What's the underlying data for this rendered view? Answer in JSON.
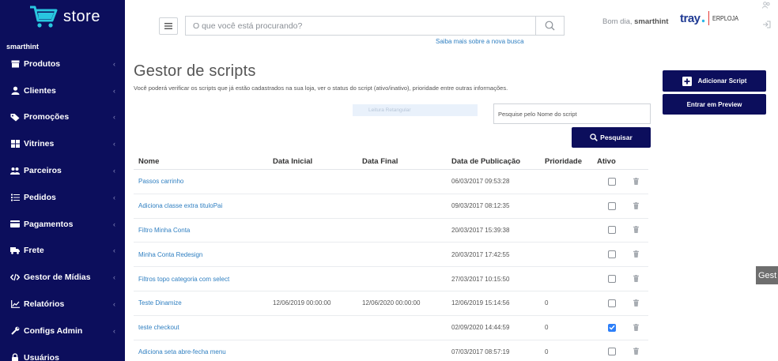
{
  "brand": {
    "logo_text": "store",
    "account": "smarthint"
  },
  "sidebar": {
    "items": [
      {
        "label": "Produtos",
        "icon": "box-icon"
      },
      {
        "label": "Clientes",
        "icon": "user-icon"
      },
      {
        "label": "Promoções",
        "icon": "tag-icon"
      },
      {
        "label": "Vitrines",
        "icon": "grid-icon"
      },
      {
        "label": "Parceiros",
        "icon": "users-icon"
      },
      {
        "label": "Pedidos",
        "icon": "list-icon"
      },
      {
        "label": "Pagamentos",
        "icon": "card-icon"
      },
      {
        "label": "Frete",
        "icon": "truck-icon"
      },
      {
        "label": "Gestor de Mídias",
        "icon": "code-icon"
      },
      {
        "label": "Relatórios",
        "icon": "chart-icon"
      },
      {
        "label": "Configs Admin",
        "icon": "wrench-icon"
      },
      {
        "label": "Usuários",
        "icon": "lock-icon"
      }
    ]
  },
  "header": {
    "search_placeholder": "O que você está procurando?",
    "search_hint": "Saiba mais sobre a nova busca",
    "greeting": "Bom dia,",
    "user": "smarthint",
    "tray": "tray",
    "erp": "ERPLOJA"
  },
  "page": {
    "title": "Gestor de scripts",
    "description": "Você poderá verificar os scripts que já estão cadastrados na sua loja, ver o status do script (ativo/inativo), prioridade entre outras informações.",
    "filter_chip": "Leitura Retangular",
    "filter_placeholder": "Pesquise pelo Nome do script",
    "search_button": "Pesquisar",
    "add_button": "Adicionar Script",
    "preview_button": "Entrar em Preview",
    "side_tab": "Gest"
  },
  "table": {
    "headers": [
      "Nome",
      "Data Inicial",
      "Data Final",
      "Data de Publicação",
      "Prioridade",
      "Ativo"
    ],
    "rows": [
      {
        "name": "Passos carrinho",
        "start": "",
        "end": "",
        "published": "06/03/2017 09:53:28",
        "priority": "",
        "active": false
      },
      {
        "name": "Adiciona classe extra tituloPai",
        "start": "",
        "end": "",
        "published": "09/03/2017 08:12:35",
        "priority": "",
        "active": false
      },
      {
        "name": "Filtro Minha Conta",
        "start": "",
        "end": "",
        "published": "20/03/2017 15:39:38",
        "priority": "",
        "active": false
      },
      {
        "name": "Minha Conta Redesign",
        "start": "",
        "end": "",
        "published": "20/03/2017 17:42:55",
        "priority": "",
        "active": false
      },
      {
        "name": "Filtros topo categoria com select",
        "start": "",
        "end": "",
        "published": "27/03/2017 10:15:50",
        "priority": "",
        "active": false
      },
      {
        "name": "Teste Dinamize",
        "start": "12/06/2019 00:00:00",
        "end": "12/06/2020 00:00:00",
        "published": "12/06/2019 15:14:56",
        "priority": "0",
        "active": false
      },
      {
        "name": "teste checkout",
        "start": "",
        "end": "",
        "published": "02/09/2020 14:44:59",
        "priority": "0",
        "active": true
      },
      {
        "name": "Adiciona seta abre-fecha menu",
        "start": "",
        "end": "",
        "published": "07/03/2017 08:57:19",
        "priority": "0",
        "active": false
      }
    ]
  },
  "colors": {
    "navy": "#0c0e5c",
    "link": "#2f7fc1",
    "checked": "#2d7ff9"
  }
}
